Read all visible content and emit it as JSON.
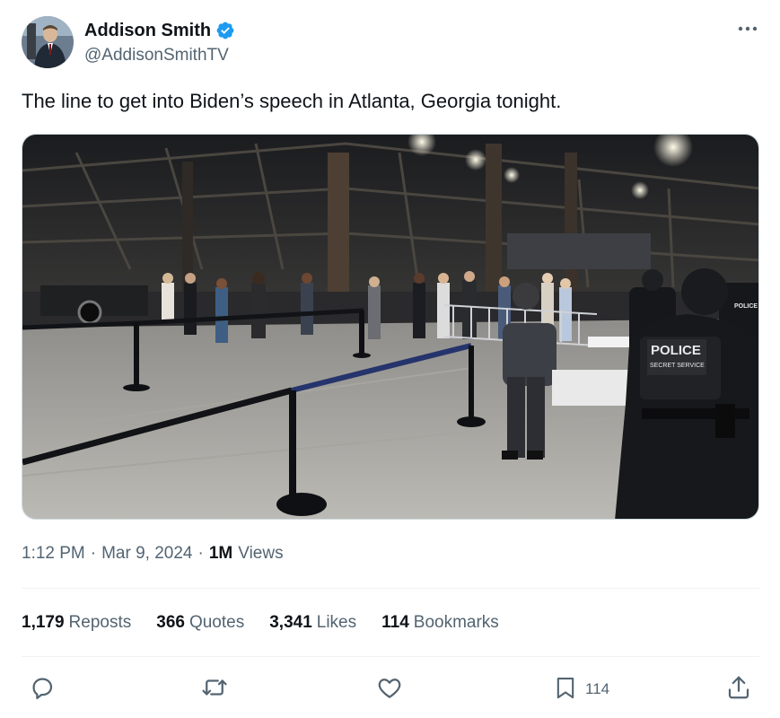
{
  "author": {
    "display_name": "Addison Smith",
    "handle": "@AddisonSmithTV",
    "verified_color": "#1d9bf0"
  },
  "tweet": {
    "text": "The line to get into Biden’s speech in Atlanta, Georgia tonight."
  },
  "meta": {
    "time": "1:12 PM",
    "sep1": "·",
    "date": "Mar 9, 2024",
    "sep2": "·",
    "views_count": "1M",
    "views_label": "Views"
  },
  "stats": {
    "reposts_count": "1,179",
    "reposts_label": "Reposts",
    "quotes_count": "366",
    "quotes_label": "Quotes",
    "likes_count": "3,341",
    "likes_label": "Likes",
    "bookmarks_count": "114",
    "bookmarks_label": "Bookmarks"
  },
  "actions": {
    "bookmark_count": "114"
  },
  "media": {
    "badge_text": "POLICE",
    "badge_subtext": "SECRET SERVICE",
    "patch_text": "POLICE"
  },
  "icons": {
    "verified": "verified-badge-icon",
    "more": "more-horizontal-icon",
    "reply": "reply-icon",
    "repost": "repost-icon",
    "like": "like-icon",
    "bookmark": "bookmark-icon",
    "share": "share-icon"
  },
  "colors": {
    "text": "#0f1419",
    "secondary": "#536471",
    "accent": "#1d9bf0",
    "divider": "#eff3f4"
  }
}
